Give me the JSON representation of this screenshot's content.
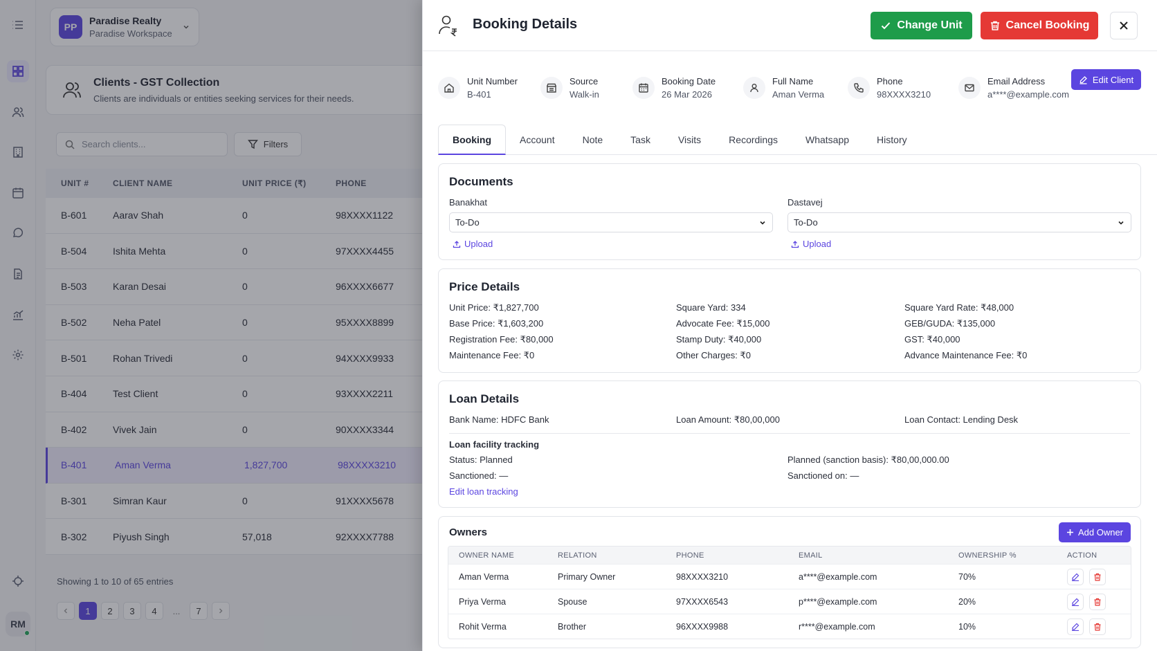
{
  "workspace": {
    "initials": "PP",
    "name": "Paradise Realty",
    "sub": "Paradise Workspace"
  },
  "user": {
    "initials": "RM"
  },
  "page": {
    "title": "Clients - GST Collection",
    "subtitle": "Clients are individuals or entities seeking services for their needs."
  },
  "search": {
    "placeholder": "Search clients..."
  },
  "filters_label": "Filters",
  "table": {
    "columns": [
      "UNIT #",
      "CLIENT NAME",
      "UNIT PRICE (₹)",
      "PHONE"
    ],
    "rows": [
      [
        "B-601",
        "Aarav Shah",
        "0",
        "98XXXX1122"
      ],
      [
        "B-504",
        "Ishita Mehta",
        "0",
        "97XXXX4455"
      ],
      [
        "B-503",
        "Karan Desai",
        "0",
        "96XXXX6677"
      ],
      [
        "B-502",
        "Neha Patel",
        "0",
        "95XXXX8899"
      ],
      [
        "B-501",
        "Rohan Trivedi",
        "0",
        "94XXXX9933"
      ],
      [
        "B-404",
        "Test Client",
        "0",
        "93XXXX2211"
      ],
      [
        "B-402",
        "Vivek Jain",
        "0",
        "90XXXX3344"
      ],
      [
        "B-401",
        "Aman Verma",
        "1,827,700",
        "98XXXX3210"
      ],
      [
        "B-301",
        "Simran Kaur",
        "0",
        "91XXXX5678"
      ],
      [
        "B-302",
        "Piyush Singh",
        "57,018",
        "92XXXX7788"
      ]
    ]
  },
  "showing": "Showing 1 to 10 of 65 entries",
  "pagination": [
    "1",
    "2",
    "3",
    "4",
    "...",
    "7"
  ],
  "drawer": {
    "title": "Booking Details",
    "change_unit": "Change Unit",
    "cancel_booking": "Cancel Booking",
    "edit_client": "Edit Client",
    "info": [
      {
        "label": "Unit Number",
        "value": "B-401"
      },
      {
        "label": "Source",
        "value": "Walk-in"
      },
      {
        "label": "Booking Date",
        "value": "26 Mar 2026"
      },
      {
        "label": "Full Name",
        "value": "Aman Verma"
      },
      {
        "label": "Phone",
        "value": "98XXXX3210"
      },
      {
        "label": "Email Address",
        "value": "a****@example.com"
      }
    ],
    "tabs": [
      "Booking",
      "Account",
      "Note",
      "Task",
      "Visits",
      "Recordings",
      "Whatsapp",
      "History"
    ],
    "documents": {
      "title": "Documents",
      "banakhat_label": "Banakhat",
      "banakhat_value": "To-Do",
      "dastavej_label": "Dastavej",
      "dastavej_value": "To-Do",
      "upload": "Upload"
    },
    "price": {
      "title": "Price Details",
      "items": [
        "Unit Price: ₹1,827,700",
        "Square Yard: 334",
        "Square Yard Rate: ₹48,000",
        "Base Price: ₹1,603,200",
        "Advocate Fee: ₹15,000",
        "GEB/GUDA: ₹135,000",
        "Registration Fee: ₹80,000",
        "Stamp Duty: ₹40,000",
        "GST: ₹40,000",
        "Maintenance Fee: ₹0",
        "Other Charges: ₹0",
        "Advance Maintenance Fee: ₹0"
      ]
    },
    "loan": {
      "title": "Loan Details",
      "bank": "Bank Name: HDFC Bank",
      "amount": "Loan Amount: ₹80,00,000",
      "contact": "Loan Contact: Lending Desk",
      "tracking_title": "Loan facility tracking",
      "status": "Status: Planned",
      "planned": "Planned (sanction basis): ₹80,00,000.00",
      "sanctioned": "Sanctioned: —",
      "sanctioned_on": "Sanctioned on: —",
      "edit_link": "Edit loan tracking"
    },
    "owners": {
      "title": "Owners",
      "add": "Add Owner",
      "columns": [
        "OWNER NAME",
        "RELATION",
        "PHONE",
        "EMAIL",
        "OWNERSHIP %",
        "ACTION"
      ],
      "rows": [
        [
          "Aman Verma",
          "Primary Owner",
          "98XXXX3210",
          "a****@example.com",
          "70%"
        ],
        [
          "Priya Verma",
          "Spouse",
          "97XXXX6543",
          "p****@example.com",
          "20%"
        ],
        [
          "Rohit Verma",
          "Brother",
          "96XXXX9988",
          "r****@example.com",
          "10%"
        ]
      ]
    }
  },
  "colors": {
    "accent": "#5b45e0",
    "success": "#1e9c4a",
    "danger": "#e53935"
  }
}
